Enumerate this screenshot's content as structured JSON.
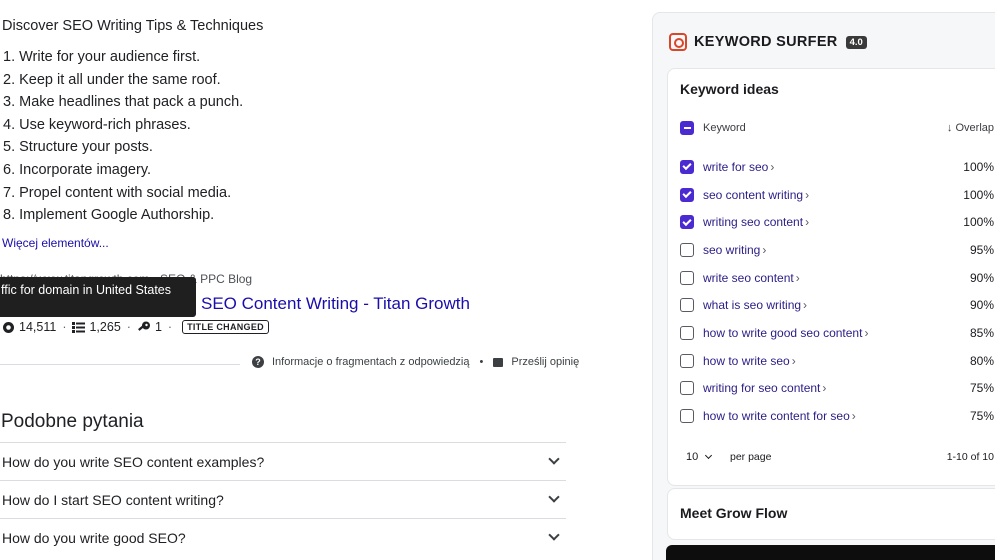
{
  "snippet": {
    "title": "Discover SEO Writing Tips & Techniques",
    "steps": [
      "1. Write for your audience first.",
      "2. Keep it all under the same roof.",
      "3. Make headlines that pack a punch.",
      "4. Use keyword-rich phrases.",
      "5. Structure your posts.",
      "6. Incorporate imagery.",
      "7. Propel content with social media.",
      "8. Implement Google Authorship."
    ],
    "more_link": "Więcej elementów..."
  },
  "result": {
    "site_url": "https://www.titangrowth.com › SEO & PPC Blog",
    "tooltip": "ffic for domain in United States",
    "title": "SEO Content Writing - Titan Growth",
    "stats": {
      "traffic": "14,511",
      "keywords": "1,265",
      "backlinks": "1",
      "badge": "TITLE CHANGED"
    }
  },
  "about": {
    "help_icon": "?",
    "label": "Informacje o fragmentach z odpowiedzią",
    "dot": "•",
    "feedback": "Prześlij opinię"
  },
  "paa": {
    "heading": "Podobne pytania",
    "questions": [
      "How do you write SEO content examples?",
      "How do I start SEO content writing?",
      "How do you write good SEO?"
    ]
  },
  "keyword_surfer": {
    "title": "KEYWORD SURFER",
    "version": "4.0",
    "card_title": "Keyword ideas",
    "col_keyword": "Keyword",
    "col_overlap": "↓ Overlap",
    "rows": [
      {
        "keyword": "write for seo",
        "overlap": "100%",
        "checked": true
      },
      {
        "keyword": "seo content writing",
        "overlap": "100%",
        "checked": true
      },
      {
        "keyword": "writing seo content",
        "overlap": "100%",
        "checked": true
      },
      {
        "keyword": "seo writing",
        "overlap": "95%",
        "checked": false
      },
      {
        "keyword": "write seo content",
        "overlap": "90%",
        "checked": false
      },
      {
        "keyword": "what is seo writing",
        "overlap": "90%",
        "checked": false
      },
      {
        "keyword": "how to write good seo content",
        "overlap": "85%",
        "checked": false
      },
      {
        "keyword": "how to write seo",
        "overlap": "80%",
        "checked": false
      },
      {
        "keyword": "writing for seo content",
        "overlap": "75%",
        "checked": false
      },
      {
        "keyword": "how to write content for seo",
        "overlap": "75%",
        "checked": false
      }
    ],
    "page_size": "10",
    "per_page": "per page",
    "range": "1-10 of 10",
    "grow_title": "Meet Grow Flow",
    "accent": "#4b2ad1"
  }
}
